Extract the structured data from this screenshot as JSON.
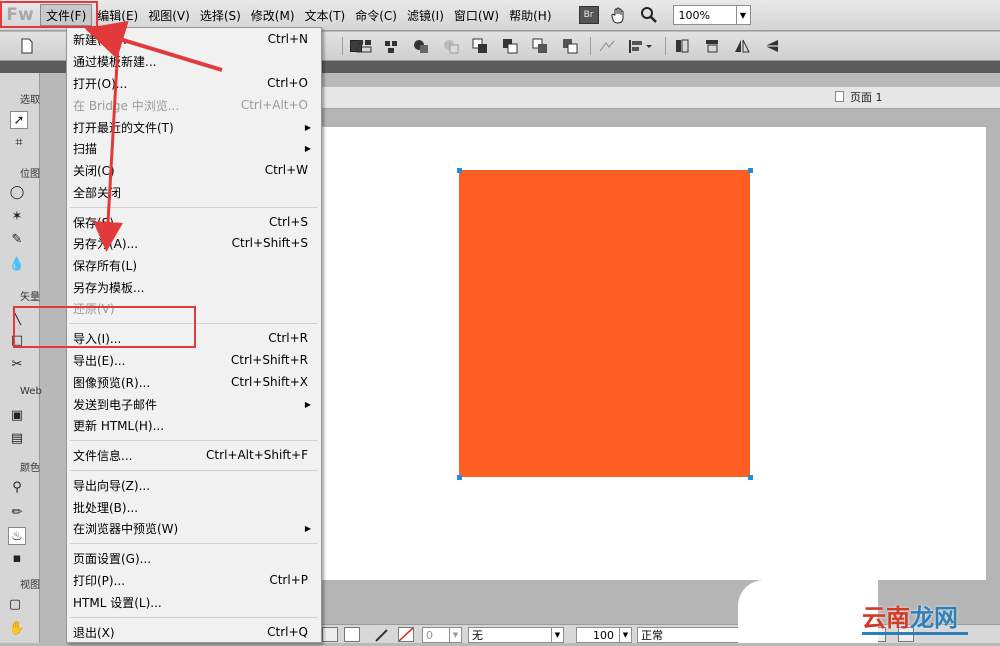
{
  "app": {
    "logo": "Fw"
  },
  "menubar": {
    "items": [
      "文件(F)",
      "编辑(E)",
      "视图(V)",
      "选择(S)",
      "修改(M)",
      "文本(T)",
      "命令(C)",
      "滤镜(I)",
      "窗口(W)",
      "帮助(H)"
    ],
    "bridge_badge": "Br",
    "zoom_value": "100%"
  },
  "tools_panel": {
    "sections": [
      "选取",
      "位图",
      "矢量",
      "Web",
      "颜色",
      "视图"
    ]
  },
  "document": {
    "page_label": "页面 1",
    "shape_color": "#ff5e22"
  },
  "file_menu": {
    "items": [
      {
        "label": "新建(N)...",
        "shortcut": "Ctrl+N"
      },
      {
        "label": "通过模板新建...",
        "shortcut": ""
      },
      {
        "label": "打开(O)...",
        "shortcut": "Ctrl+O"
      },
      {
        "label": "在 Bridge 中浏览...",
        "shortcut": "Ctrl+Alt+O",
        "disabled": true
      },
      {
        "label": "打开最近的文件(T)",
        "shortcut": "",
        "submenu": true
      },
      {
        "label": "扫描",
        "shortcut": "",
        "submenu": true
      },
      {
        "label": "关闭(C)",
        "shortcut": "Ctrl+W"
      },
      {
        "label": "全部关闭",
        "shortcut": ""
      },
      {
        "label": "保存(S)",
        "shortcut": "Ctrl+S"
      },
      {
        "label": "另存为(A)...",
        "shortcut": "Ctrl+Shift+S"
      },
      {
        "label": "保存所有(L)",
        "shortcut": ""
      },
      {
        "label": "另存为模板...",
        "shortcut": ""
      },
      {
        "label": "还原(V)",
        "shortcut": "",
        "disabled": true
      },
      {
        "label": "导入(I)...",
        "shortcut": "Ctrl+R"
      },
      {
        "label": "导出(E)...",
        "shortcut": "Ctrl+Shift+R"
      },
      {
        "label": "图像预览(R)...",
        "shortcut": "Ctrl+Shift+X"
      },
      {
        "label": "发送到电子邮件",
        "shortcut": "",
        "submenu": true
      },
      {
        "label": "更新 HTML(H)...",
        "shortcut": ""
      },
      {
        "label": "文件信息...",
        "shortcut": "Ctrl+Alt+Shift+F"
      },
      {
        "label": "导出向导(Z)...",
        "shortcut": ""
      },
      {
        "label": "批处理(B)...",
        "shortcut": ""
      },
      {
        "label": "在浏览器中预览(W)",
        "shortcut": "",
        "submenu": true
      },
      {
        "label": "页面设置(G)...",
        "shortcut": ""
      },
      {
        "label": "打印(P)...",
        "shortcut": "Ctrl+P"
      },
      {
        "label": "HTML 设置(L)...",
        "shortcut": ""
      },
      {
        "label": "退出(X)",
        "shortcut": "Ctrl+Q"
      }
    ]
  },
  "statusbar": {
    "stroke_size": "0",
    "texture": "无",
    "opacity": "100",
    "blend_mode": "正常"
  },
  "watermark": {
    "part1": "云南",
    "part2": "龙网"
  },
  "icons": [
    "hand-icon",
    "zoom-icon",
    "pointer-icon",
    "crop-icon",
    "marquee-icon",
    "magic-wand-icon",
    "pen-icon",
    "blur-icon",
    "line-icon",
    "rectangle-icon",
    "knife-icon",
    "hotspot-icon",
    "eyedropper-icon",
    "pencil-icon",
    "paint-bucket-icon",
    "hand-view-icon",
    "page-icon"
  ],
  "colors": {
    "accent_annotation": "#e23a3a",
    "shape_fill": "#ff5e22",
    "selection_handle": "#1e8fd8"
  }
}
